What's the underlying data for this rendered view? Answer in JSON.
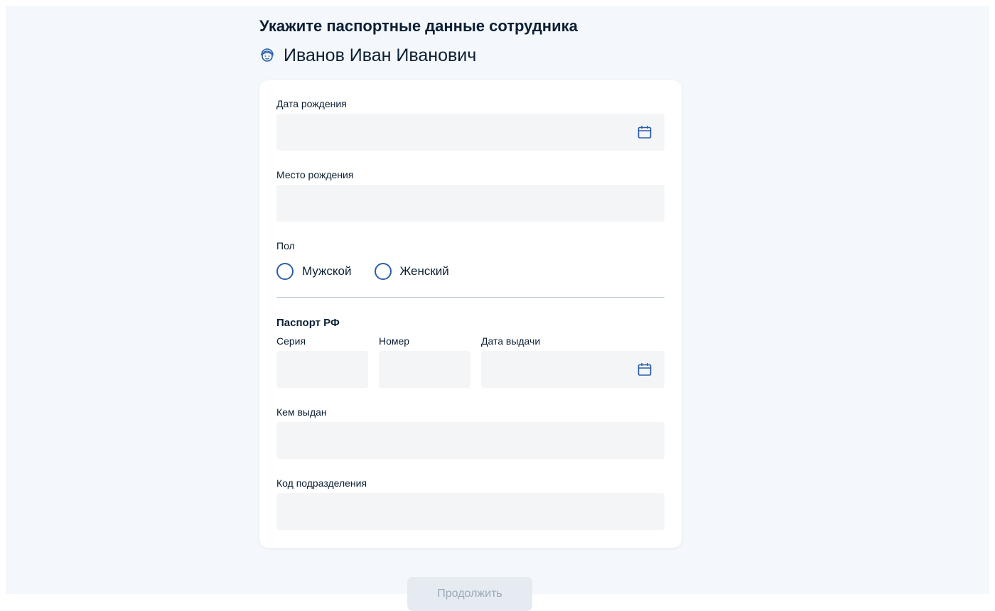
{
  "heading": "Укажите паспортные данные сотрудника",
  "employee": {
    "name": "Иванов Иван Иванович",
    "icon": "user-face-icon"
  },
  "form": {
    "birth_date": {
      "label": "Дата рождения",
      "value": "",
      "icon": "calendar-icon"
    },
    "birth_place": {
      "label": "Место рождения",
      "value": ""
    },
    "gender": {
      "label": "Пол",
      "options": [
        "Мужской",
        "Женский"
      ],
      "selected": null
    },
    "passport": {
      "title": "Паспорт РФ",
      "series": {
        "label": "Серия",
        "value": ""
      },
      "number": {
        "label": "Номер",
        "value": ""
      },
      "issue_date": {
        "label": "Дата выдачи",
        "value": "",
        "icon": "calendar-icon"
      },
      "issued_by": {
        "label": "Кем выдан",
        "value": ""
      },
      "division_code": {
        "label": "Код подразделения",
        "value": ""
      }
    }
  },
  "actions": {
    "continue_label": "Продолжить",
    "continue_disabled": true
  },
  "colors": {
    "accent": "#2b5ea8",
    "text": "#0b1f33",
    "field_background": "#f4f5f7",
    "page_background": "#f4f7fb",
    "button_disabled_background": "#e6ebf2",
    "button_disabled_text": "#9aa8b8"
  }
}
